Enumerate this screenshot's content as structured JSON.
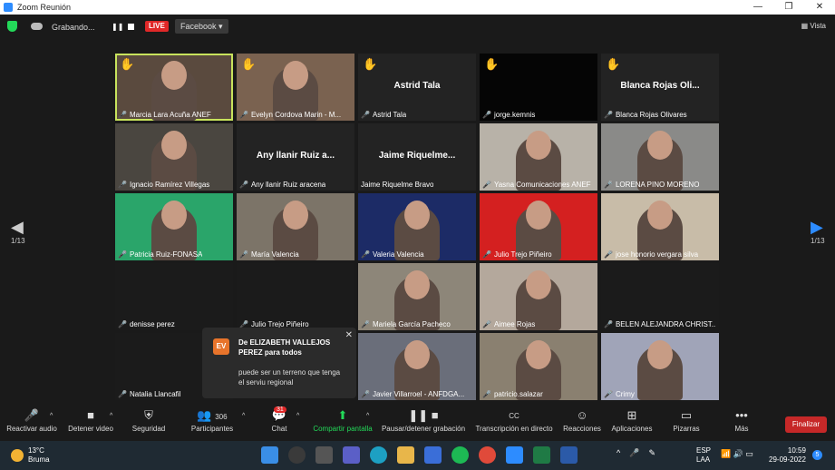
{
  "window": {
    "title": "Zoom Reunión",
    "controls": [
      "—",
      "❐",
      "✕"
    ]
  },
  "topbar": {
    "recording_text": "Grabando...",
    "live_label": "LIVE",
    "stream_target": "Facebook",
    "view_label": "Vista"
  },
  "participants": [
    {
      "name": "Marcia Lara Acuña ANEF",
      "video": true,
      "hand": true,
      "active": true
    },
    {
      "name": "Evelyn Cordova Marin - M...",
      "video": true,
      "hand": true
    },
    {
      "name": "Astrid Tala",
      "bigname": "Astrid Tala",
      "video": false,
      "hand": true
    },
    {
      "name": "jorge.kemnis",
      "video": false,
      "hand": true
    },
    {
      "name": "Blanca Rojas Olivares",
      "bigname": "Blanca Rojas Oli...",
      "video": false,
      "hand": true
    },
    {
      "name": "Ignacio Ramírez Villegas",
      "video": true
    },
    {
      "name": "Any llanir Ruiz aracena",
      "bigname": "Any llanir Ruiz a...",
      "video": false
    },
    {
      "name": "Jaime Riquelme Bravo",
      "bigname": "Jaime Riquelme...",
      "video": false,
      "nomic": true
    },
    {
      "name": "Yasna Comunicaciones ANEF",
      "video": true
    },
    {
      "name": "LORENA PINO MORENO",
      "video": true
    },
    {
      "name": "Patricia Ruiz-FONASA",
      "video": true
    },
    {
      "name": "María Valencia",
      "video": true
    },
    {
      "name": "Valeria Valencia",
      "video": true
    },
    {
      "name": "Julio Trejo Piñeiro",
      "video": true
    },
    {
      "name": "jose honorio vergara silva",
      "video": true
    },
    {
      "name": "denisse perez",
      "video": false
    },
    {
      "name": "Julio Trejo Piñeiro",
      "video": false
    },
    {
      "name": "Mariela García Pacheco",
      "video": true
    },
    {
      "name": "Aimee Rojas",
      "video": true
    },
    {
      "name": "BELEN ALEJANDRA CHRIST...",
      "video": false
    },
    {
      "name": "Natalia Llancafil",
      "video": false
    },
    {
      "name": "",
      "video": false,
      "hidden": true
    },
    {
      "name": "Javier Villarroel - ANFDGA...",
      "video": true
    },
    {
      "name": "patricio.salazar",
      "video": true
    },
    {
      "name": "Crimy",
      "video": true
    }
  ],
  "pagination": {
    "left": "1/13",
    "right": "1/13"
  },
  "chat_popup": {
    "initials": "EV",
    "from": "De ELIZABETH VALLEJOS PEREZ para todos",
    "message": "puede ser un terreno que tenga el serviu regional"
  },
  "toolbar": {
    "audio": "Reactivar audio",
    "video": "Detener video",
    "security": "Seguridad",
    "participants": "Participantes",
    "participants_count": "306",
    "chat": "Chat",
    "chat_badge": "31",
    "share": "Compartir pantalla",
    "record": "Pausar/detener grabación",
    "transcript": "Transcripción en directo",
    "reactions": "Reacciones",
    "apps": "Aplicaciones",
    "whiteboards": "Pizarras",
    "more": "Más",
    "end": "Finalizar",
    "transcript_icon_text": "CC"
  },
  "taskbar": {
    "temp": "13°C",
    "weather": "Bruma",
    "lang1": "ESP",
    "lang2": "LAA",
    "time": "10:59",
    "date": "29-09-2022",
    "notif_count": "5"
  }
}
